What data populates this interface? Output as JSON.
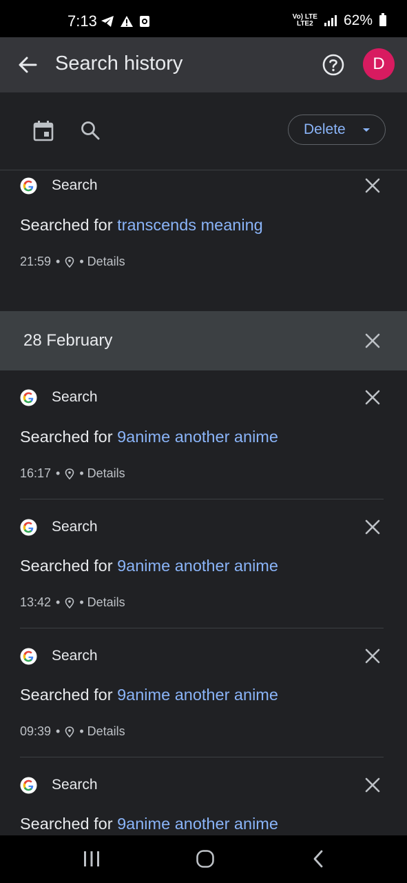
{
  "status_bar": {
    "time": "7:13",
    "network_top": "Vo) LTE",
    "network_bottom": "LTE2",
    "battery": "62%"
  },
  "app_bar": {
    "title": "Search history",
    "avatar_letter": "D",
    "avatar_color": "#d81b60"
  },
  "toolbar": {
    "delete_label": "Delete"
  },
  "first_item": {
    "source": "Search",
    "prefix": "Searched for ",
    "query": "transcends meaning",
    "time": "21:59",
    "sep1": "•",
    "sep2": "• Details"
  },
  "date_group": {
    "label": "28 February",
    "items": [
      {
        "source": "Search",
        "prefix": "Searched for ",
        "query": "9anime another anime",
        "time": "16:17",
        "sep1": "•",
        "sep2": "• Details"
      },
      {
        "source": "Search",
        "prefix": "Searched for ",
        "query": "9anime another anime",
        "time": "13:42",
        "sep1": "•",
        "sep2": "• Details"
      },
      {
        "source": "Search",
        "prefix": "Searched for ",
        "query": "9anime another anime",
        "time": "09:39",
        "sep1": "•",
        "sep2": "• Details"
      },
      {
        "source": "Search",
        "prefix": "Searched for ",
        "query": "9anime another anime"
      }
    ]
  },
  "colors": {
    "background": "#202124",
    "app_bar": "#35363a",
    "accent_link": "#8ab4f8",
    "date_header": "#3c4043"
  },
  "icons": {
    "back": "arrow-left-icon",
    "help": "help-circle-icon",
    "calendar": "calendar-icon",
    "search": "search-icon",
    "close": "close-icon",
    "location": "location-pin-icon",
    "google": "google-g-icon"
  }
}
